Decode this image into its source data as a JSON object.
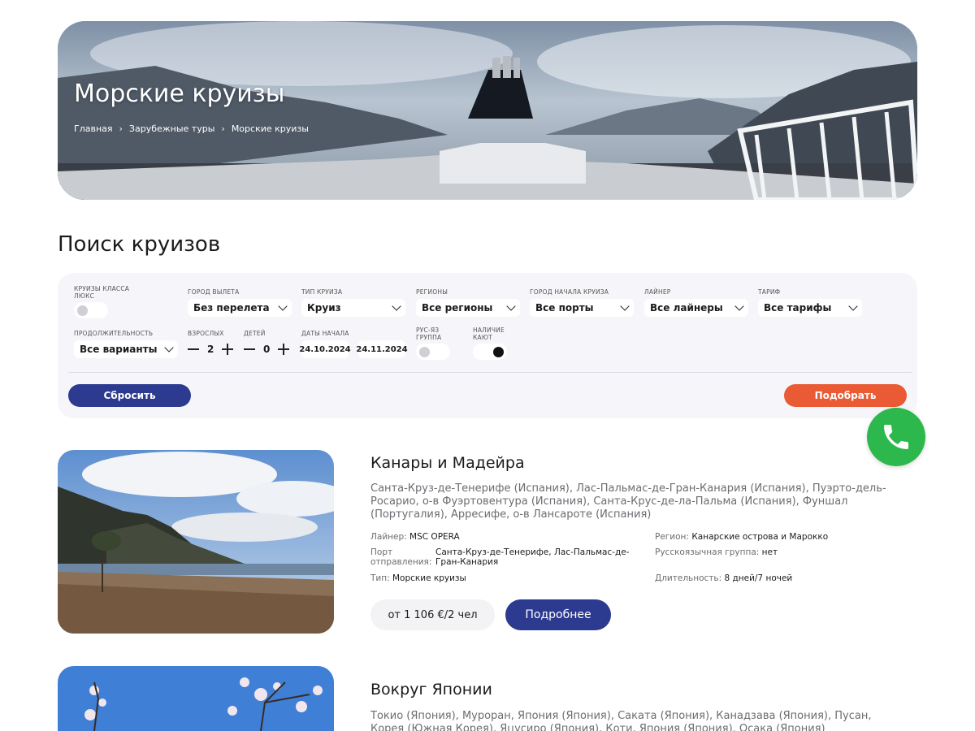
{
  "hero": {
    "title": "Морские круизы",
    "breadcrumb": [
      "Главная",
      "Зарубежные туры",
      "Морские круизы"
    ],
    "separator": "›"
  },
  "search": {
    "title": "Поиск круизов",
    "luxury_label": "Круизы класса люкс",
    "luxury_on": false,
    "departure": {
      "label": "Город вылета",
      "value": "Без перелета"
    },
    "cruise_type": {
      "label": "Тип круиза",
      "value": "Круиз"
    },
    "regions": {
      "label": "Регионы",
      "value": "Все регионы"
    },
    "start_city": {
      "label": "Город начала круиза",
      "value": "Все порты"
    },
    "liner": {
      "label": "Лайнер",
      "value": "Все лайнеры"
    },
    "tariff": {
      "label": "Тариф",
      "value": "Все тарифы"
    },
    "duration": {
      "label": "Продолжительность",
      "value": "Все варианты"
    },
    "adults": {
      "label": "Взрослых",
      "value": "2"
    },
    "children": {
      "label": "Детей",
      "value": "0"
    },
    "dates": {
      "label": "Даты начала",
      "from": "24.10.2024",
      "to": "24.11.2024"
    },
    "ru_group": {
      "label": "Рус-яз группа",
      "on": false
    },
    "cabins": {
      "label": "Наличие кают",
      "on": true
    },
    "reset_label": "Сбросить",
    "submit_label": "Подобрать"
  },
  "cruises": [
    {
      "title": "Канары и Мадейра",
      "route": "Санта-Круз-де-Тенерифе (Испания), Лас-Пальмас-де-Гран-Канария (Испания), Пуэрто-дель-Росарио, о-в Фуэртовентура (Испания), Санта-Крус-де-ла-Пальма (Испания), Фуншал (Португалия), Арресифе, о-в Лансароте (Испания)",
      "liner_key": "Лайнер:",
      "liner": "MSC OPERA",
      "port_key": "Порт отправления:",
      "port": "Санта-Круз-де-Тенерифе, Лас-Пальмас-де-Гран-Канария",
      "type_key": "Тип:",
      "type": "Морские круизы",
      "region_key": "Регион:",
      "region": "Канарские острова и Марокко",
      "ru_key": "Русскоязычная группа:",
      "ru": "нет",
      "duration_key": "Длительность:",
      "duration": "8 дней/7 ночей",
      "price": "от 1 106 €/2 чел",
      "more_label": "Подробнее"
    },
    {
      "title": "Вокруг Японии",
      "route": "Токио (Япония), Муроран, Япония (Япония), Саката (Япония), Канадзава (Япония), Пусан, Корея (Южная Корея), Яцусиро (Япония), Коти, Япония (Япония), Осака (Япония)"
    }
  ],
  "icons": {
    "phone": "phone-icon",
    "chevron": "chevron-down-icon"
  },
  "colors": {
    "primary": "#2c3a8f",
    "accent": "#e95a35",
    "call": "#2db84d"
  }
}
